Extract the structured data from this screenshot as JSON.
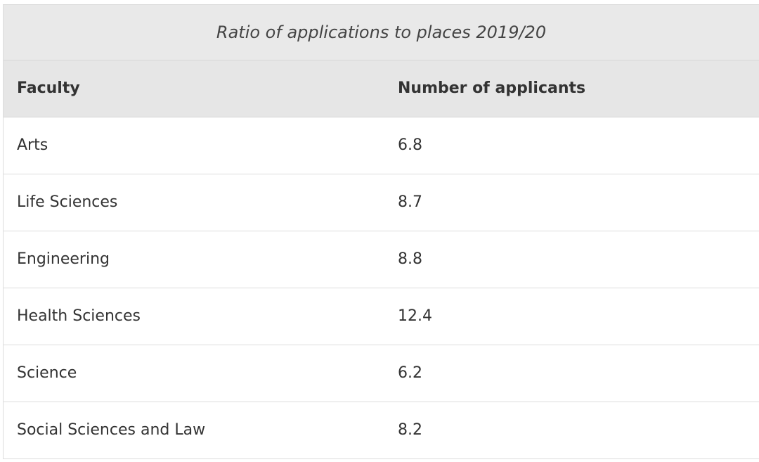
{
  "table": {
    "caption": "Ratio of applications to places 2019/20",
    "headers": [
      "Faculty",
      "Number of applicants"
    ],
    "rows": [
      [
        "Arts",
        "6.8"
      ],
      [
        "Life Sciences",
        "8.7"
      ],
      [
        "Engineering",
        "8.8"
      ],
      [
        "Health Sciences",
        "12.4"
      ],
      [
        "Science",
        "6.2"
      ],
      [
        "Social Sciences and Law",
        "8.2"
      ]
    ]
  }
}
